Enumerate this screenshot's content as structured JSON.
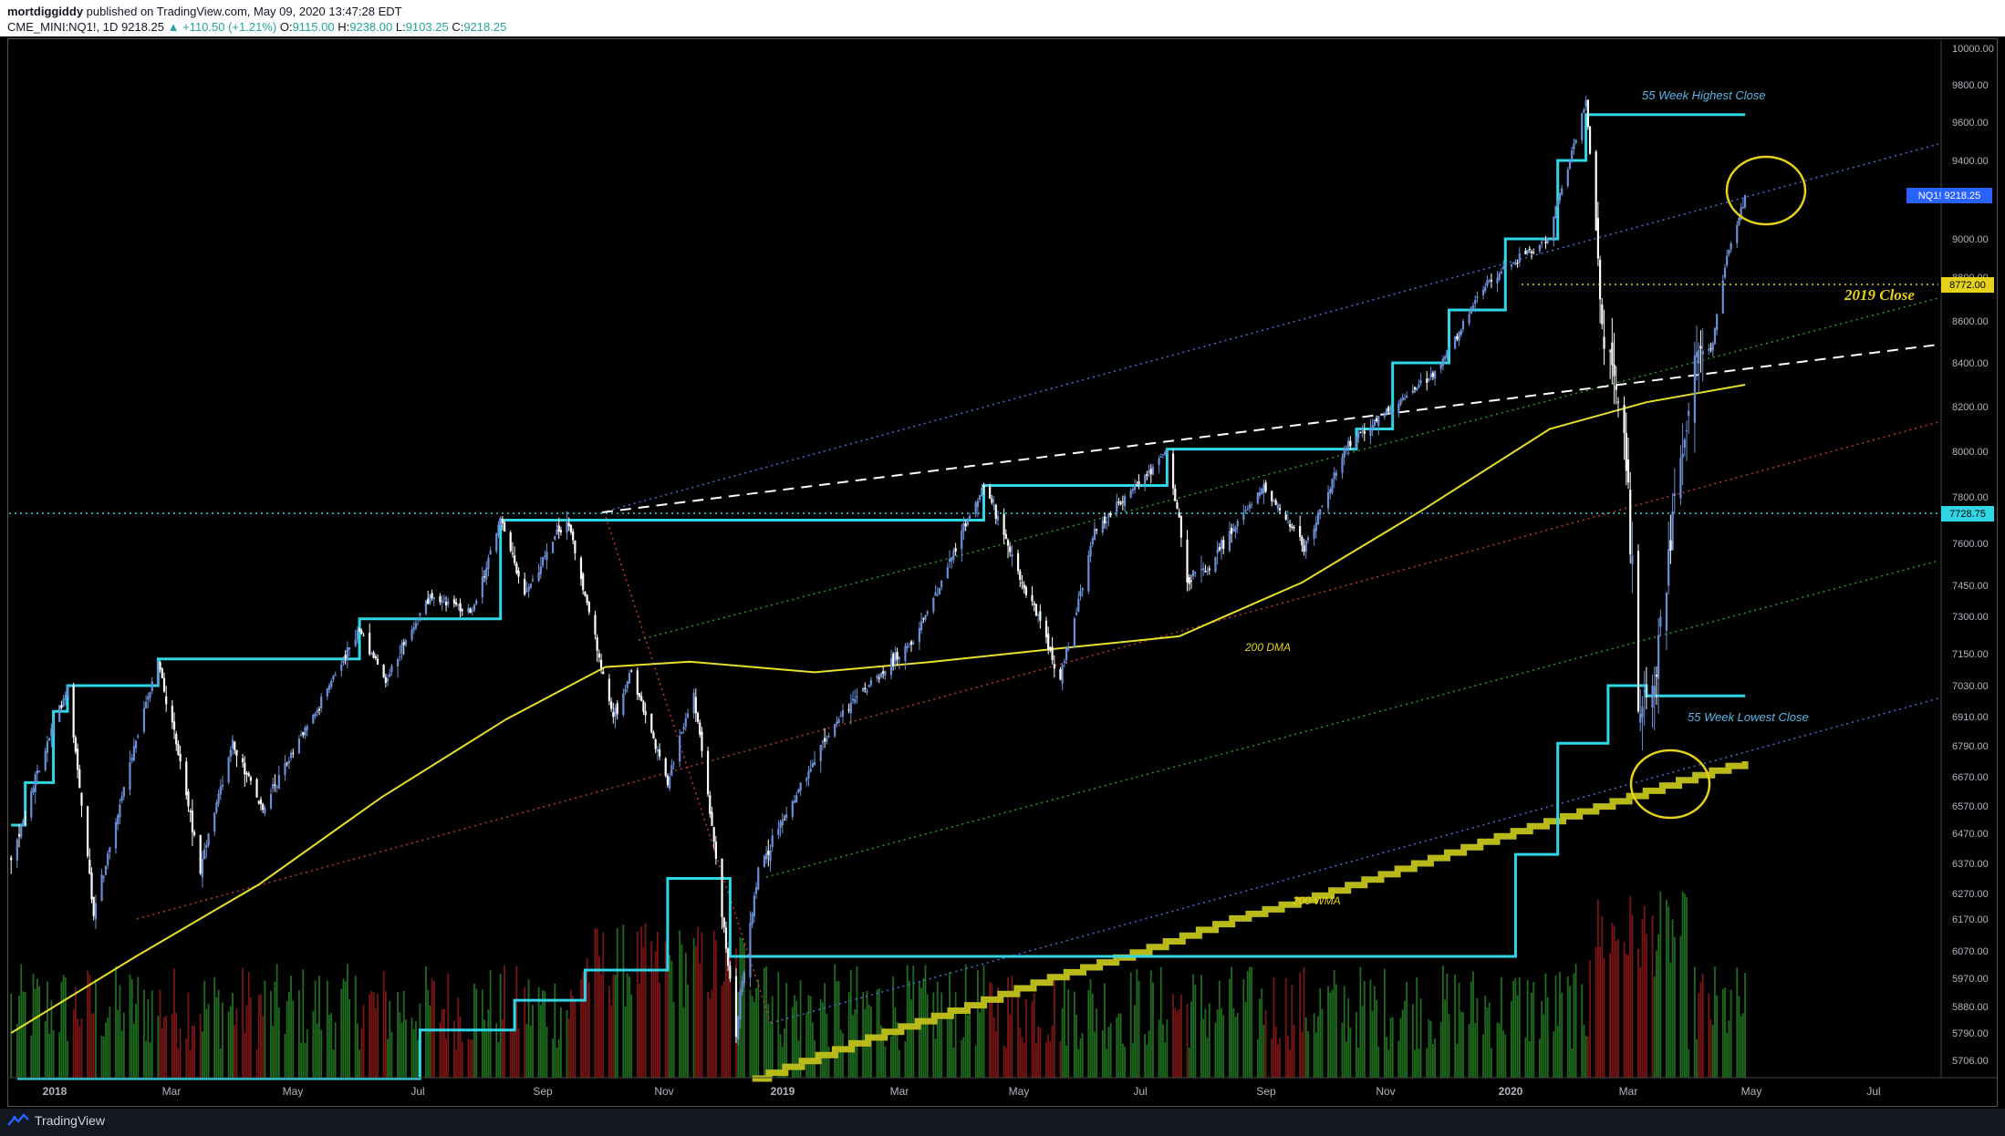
{
  "header": {
    "author": "mortdiggiddy",
    "published_text": "published on TradingView.com, May 09, 2020 13:47:28 EDT",
    "symbol": "CME_MINI:NQ1!, 1D",
    "last": "9218.25",
    "change": "▲ +110.50 (+1.21%)",
    "o_label": "O:",
    "o_value": "9115.00",
    "h_label": "H:",
    "h_value": "9238.00",
    "l_label": "L:",
    "l_value": "9103.25",
    "c_label": "C:",
    "c_value": "9218.25"
  },
  "footer": {
    "brand": "TradingView",
    "logo_icon": "tradingview-logo-icon"
  },
  "colors": {
    "background": "#000000",
    "candle": "#ffffff",
    "candle_up": "#6b8fd6",
    "channel_cyan": "#2ed6e6",
    "dma": "#e6e02a",
    "wma": "#b9b91a",
    "blue_dotted": "#4a6fd8",
    "green_dotted": "#2c9a2c",
    "red_dotted": "#c0392b",
    "white_dashed": "#ffffff",
    "vol_up": "#1f6b1f",
    "vol_down": "#7a1515",
    "annot_blue": "#5bb6e6",
    "annot_yellow": "#e6d21a",
    "price_tag": "#2962ff",
    "close_tag": "#e6d21a",
    "level_tag": "#2ed6e6"
  },
  "chart_data": {
    "type": "candlestick",
    "title": "",
    "xlabel": "",
    "ylabel": "",
    "x_ticks": [
      "2018",
      "Mar",
      "May",
      "Jul",
      "Sep",
      "Nov",
      "2019",
      "Mar",
      "May",
      "Jul",
      "Sep",
      "Nov",
      "2020",
      "Mar",
      "May",
      "Jul"
    ],
    "y_ticks": [
      "10000.00",
      "9800.00",
      "9600.00",
      "9400.00",
      "9200.00",
      "9000.00",
      "8800.00",
      "8600.00",
      "8400.00",
      "8200.00",
      "8000.00",
      "7800.00",
      "7600.00",
      "7450.00",
      "7300.00",
      "7150.00",
      "7030.00",
      "6910.00",
      "6790.00",
      "6670.00",
      "6570.00",
      "6470.00",
      "6370.00",
      "6270.00",
      "6170.00",
      "6070.00",
      "5970.00",
      "5880.00",
      "5790.00",
      "5706.00"
    ],
    "ylim": [
      5650,
      10080
    ],
    "grid": false,
    "price_close_anchors": [
      {
        "date": "2017-12-29",
        "close": 6380
      },
      {
        "date": "2018-01-26",
        "close": 7030
      },
      {
        "date": "2018-02-08",
        "close": 6200
      },
      {
        "date": "2018-03-12",
        "close": 7130
      },
      {
        "date": "2018-04-02",
        "close": 6350
      },
      {
        "date": "2018-04-18",
        "close": 6800
      },
      {
        "date": "2018-05-03",
        "close": 6550
      },
      {
        "date": "2018-06-20",
        "close": 7250
      },
      {
        "date": "2018-07-03",
        "close": 7050
      },
      {
        "date": "2018-07-25",
        "close": 7400
      },
      {
        "date": "2018-08-15",
        "close": 7320
      },
      {
        "date": "2018-08-29",
        "close": 7700
      },
      {
        "date": "2018-09-10",
        "close": 7420
      },
      {
        "date": "2018-10-01",
        "close": 7710
      },
      {
        "date": "2018-10-24",
        "close": 6900
      },
      {
        "date": "2018-11-02",
        "close": 7080
      },
      {
        "date": "2018-11-20",
        "close": 6650
      },
      {
        "date": "2018-12-03",
        "close": 7000
      },
      {
        "date": "2018-12-24",
        "close": 5800
      },
      {
        "date": "2019-01-04",
        "close": 6350
      },
      {
        "date": "2019-02-15",
        "close": 6930
      },
      {
        "date": "2019-03-22",
        "close": 7200
      },
      {
        "date": "2019-04-26",
        "close": 7850
      },
      {
        "date": "2019-05-13",
        "close": 7500
      },
      {
        "date": "2019-06-03",
        "close": 7050
      },
      {
        "date": "2019-06-20",
        "close": 7650
      },
      {
        "date": "2019-07-26",
        "close": 8000
      },
      {
        "date": "2019-08-05",
        "close": 7480
      },
      {
        "date": "2019-08-15",
        "close": 7500
      },
      {
        "date": "2019-09-12",
        "close": 7850
      },
      {
        "date": "2019-10-02",
        "close": 7580
      },
      {
        "date": "2019-10-25",
        "close": 8050
      },
      {
        "date": "2019-12-06",
        "close": 8350
      },
      {
        "date": "2019-12-31",
        "close": 8772
      },
      {
        "date": "2020-01-31",
        "close": 9000
      },
      {
        "date": "2020-02-19",
        "close": 9700
      },
      {
        "date": "2020-02-28",
        "close": 8500
      },
      {
        "date": "2020-03-09",
        "close": 8100
      },
      {
        "date": "2020-03-16",
        "close": 7000
      },
      {
        "date": "2020-03-23",
        "close": 6970
      },
      {
        "date": "2020-03-31",
        "close": 7560
      },
      {
        "date": "2020-04-14",
        "close": 8500
      },
      {
        "date": "2020-04-21",
        "close": 8450
      },
      {
        "date": "2020-04-29",
        "close": 8900
      },
      {
        "date": "2020-05-08",
        "close": 9218.25
      }
    ],
    "levels": {
      "last_price": {
        "label": "NQ1!",
        "value": "9218.25"
      },
      "close_2019": {
        "value": "8772.00",
        "text": "2019 Close"
      },
      "horizontal": {
        "value": "7728.75"
      }
    },
    "channel_55_week_highest_close": [
      {
        "date": "2017-12-29",
        "value": 6500
      },
      {
        "date": "2018-01-05",
        "value": 6650
      },
      {
        "date": "2018-01-19",
        "value": 6930
      },
      {
        "date": "2018-01-26",
        "value": 7030
      },
      {
        "date": "2018-03-12",
        "value": 7130
      },
      {
        "date": "2018-06-20",
        "value": 7290
      },
      {
        "date": "2018-08-29",
        "value": 7700
      },
      {
        "date": "2019-04-26",
        "value": 7850
      },
      {
        "date": "2019-07-26",
        "value": 8010
      },
      {
        "date": "2019-10-28",
        "value": 8100
      },
      {
        "date": "2019-11-15",
        "value": 8400
      },
      {
        "date": "2019-12-13",
        "value": 8650
      },
      {
        "date": "2020-01-10",
        "value": 9000
      },
      {
        "date": "2020-02-05",
        "value": 9400
      },
      {
        "date": "2020-02-19",
        "value": 9640
      },
      {
        "date": "2020-05-08",
        "value": 9640
      }
    ],
    "channel_55_week_lowest_close": [
      {
        "date": "2018-01-01",
        "value": 5650
      },
      {
        "date": "2018-07-20",
        "value": 5800
      },
      {
        "date": "2018-09-05",
        "value": 5900
      },
      {
        "date": "2018-10-10",
        "value": 6000
      },
      {
        "date": "2018-11-20",
        "value": 6320
      },
      {
        "date": "2018-12-21",
        "value": 6050
      },
      {
        "date": "2019-12-31",
        "value": 6050
      },
      {
        "date": "2020-01-15",
        "value": 6400
      },
      {
        "date": "2020-02-05",
        "value": 6800
      },
      {
        "date": "2020-03-01",
        "value": 7030
      },
      {
        "date": "2020-03-20",
        "value": 6990
      },
      {
        "date": "2020-05-08",
        "value": 6990
      }
    ],
    "dma_200": [
      {
        "date": "2017-12-29",
        "value": 5790
      },
      {
        "date": "2018-03-01",
        "value": 6050
      },
      {
        "date": "2018-05-01",
        "value": 6300
      },
      {
        "date": "2018-07-01",
        "value": 6600
      },
      {
        "date": "2018-09-01",
        "value": 6900
      },
      {
        "date": "2018-10-20",
        "value": 7100
      },
      {
        "date": "2018-12-01",
        "value": 7120
      },
      {
        "date": "2019-02-01",
        "value": 7080
      },
      {
        "date": "2019-04-01",
        "value": 7120
      },
      {
        "date": "2019-06-01",
        "value": 7170
      },
      {
        "date": "2019-08-01",
        "value": 7220
      },
      {
        "date": "2019-10-01",
        "value": 7460
      },
      {
        "date": "2019-12-01",
        "value": 7750
      },
      {
        "date": "2020-02-01",
        "value": 8100
      },
      {
        "date": "2020-03-20",
        "value": 8220
      },
      {
        "date": "2020-05-08",
        "value": 8300
      }
    ],
    "wma_200": [
      {
        "date": "2019-01-01",
        "value": 5650
      },
      {
        "date": "2020-05-08",
        "value": 6730
      }
    ],
    "annotations": [
      {
        "text": "55 Week Highest Close",
        "color": "annot_blue"
      },
      {
        "text": "55 Week Lowest Close",
        "color": "annot_blue"
      },
      {
        "text": "200 DMA",
        "color": "annot_yellow"
      },
      {
        "text": "200 WMA",
        "color": "annot_yellow"
      },
      {
        "text": "2019 Close",
        "color": "annot_yellow"
      }
    ]
  }
}
